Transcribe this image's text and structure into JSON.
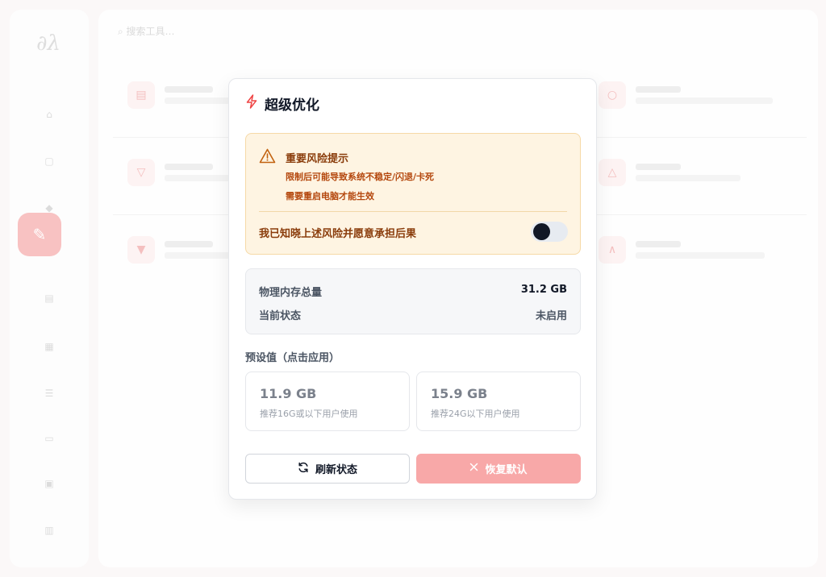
{
  "background": {
    "search_placeholder": "搜索工具…",
    "logo_glyph": "∂λ",
    "nav_icons": [
      "⌂",
      "▢",
      "◆",
      "✎",
      "▤",
      "▦",
      "☰",
      "▭",
      "▣",
      "▥"
    ]
  },
  "modal": {
    "title": "超级优化",
    "icon": "lightning-icon",
    "warning": {
      "title": "重要风险提示",
      "line1": "限制后可能导致系统不稳定/闪退/卡死",
      "line2": "需要重启电脑才能生效",
      "ack_label": "我已知晓上述风险并愿意承担后果",
      "toggle_on": false
    },
    "info": {
      "memory_label": "物理内存总量",
      "memory_value": "31.2 GB",
      "status_label": "当前状态",
      "status_value": "未启用"
    },
    "presets_title": "预设值（点击应用）",
    "presets": [
      {
        "value": "11.9 GB",
        "desc": "推荐16G或以下用户使用"
      },
      {
        "value": "15.9 GB",
        "desc": "推荐24G以下用户使用"
      }
    ],
    "buttons": {
      "refresh_label": "刷新状态",
      "restore_label": "恢复默认"
    }
  },
  "colors": {
    "accent_danger": "#ef4444",
    "warning_bg": "#fef4e2",
    "warning_text": "#b4470d",
    "restore_button": "#f8a8a8"
  }
}
